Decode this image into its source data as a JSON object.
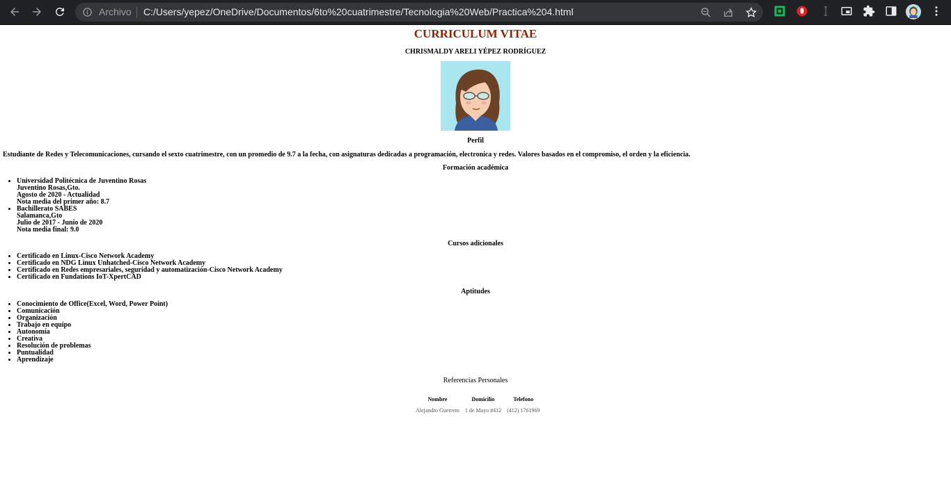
{
  "browser": {
    "chip_label": "Archivo",
    "url": "C:/Users/yepez/OneDrive/Documentos/6to%20cuatrimestre/Tecnologia%20Web/Practica%204.html"
  },
  "cv": {
    "title": "CURRICULUM VITAE",
    "name": "CHRISMALDY ARELI YÉPEZ RODRÍGUEZ",
    "perfil_heading": "Perfil",
    "perfil_text": "Estudiante de Redes y Telecomunicaciones, cursando el sexto cuatrimestre, con un promedio de 9.7 a la fecha, con asignaturas dedicadas a programación, electronica y redes. Valores basados en el compromiso, el orden y la eficiencia.",
    "formacion_heading": "Formación académica",
    "formacion": [
      {
        "lines": [
          "Universidad Politécnica de Juventino Rosas",
          "Juventino Rosas,Gto.",
          "Agosto de 2020 - Actualidad",
          "Nota media del primer año: 8.7"
        ]
      },
      {
        "lines": [
          "Bachillerato SABES",
          "Salamanca,Gto",
          "Julio de 2017 - Junio de 2020",
          "Nota media final: 9.0"
        ]
      }
    ],
    "cursos_heading": "Cursos adicionales",
    "cursos": [
      "Certificado en Linux-Cisco Network Academy",
      "Certificado en NDG Linux Unhatched-Cisco Network Academy",
      "Certificado en Redes empresariales, seguridad y automatización-Cisco Network Academy",
      "Certificado en Fundations IoT-XpertCAD"
    ],
    "aptitudes_heading": "Aptitudes",
    "aptitudes": [
      "Conocimiento de Office(Excel, Word, Power Point)",
      "Comunicación",
      "Organización",
      "Trabajo en equipo",
      "Autonomía",
      "Creativa",
      "Resolución de problemas",
      "Puntualidad",
      "Aprendizaje"
    ],
    "referencias_heading": "Referencias Personales",
    "referencias_headers": [
      "Nombre",
      "Domicilio",
      "Telefono"
    ],
    "referencias_rows": [
      [
        "Alejandro Guerrero",
        "1 de Mayo #412",
        "(412) 1761969"
      ]
    ]
  },
  "colors": {
    "title": "#8b2500",
    "toolbar": "#202124",
    "omnibox": "#35363a",
    "photo_bg": "#a9e6ef"
  },
  "icons": [
    "back-arrow-icon",
    "forward-arrow-icon",
    "reload-icon",
    "info-icon",
    "zoom-icon",
    "share-icon",
    "star-icon",
    "extension-green-icon",
    "extension-red-hand-icon",
    "extension-gray-icon",
    "media-icon",
    "puzzle-icon",
    "sidebar-icon",
    "profile-avatar",
    "more-menu-icon"
  ]
}
